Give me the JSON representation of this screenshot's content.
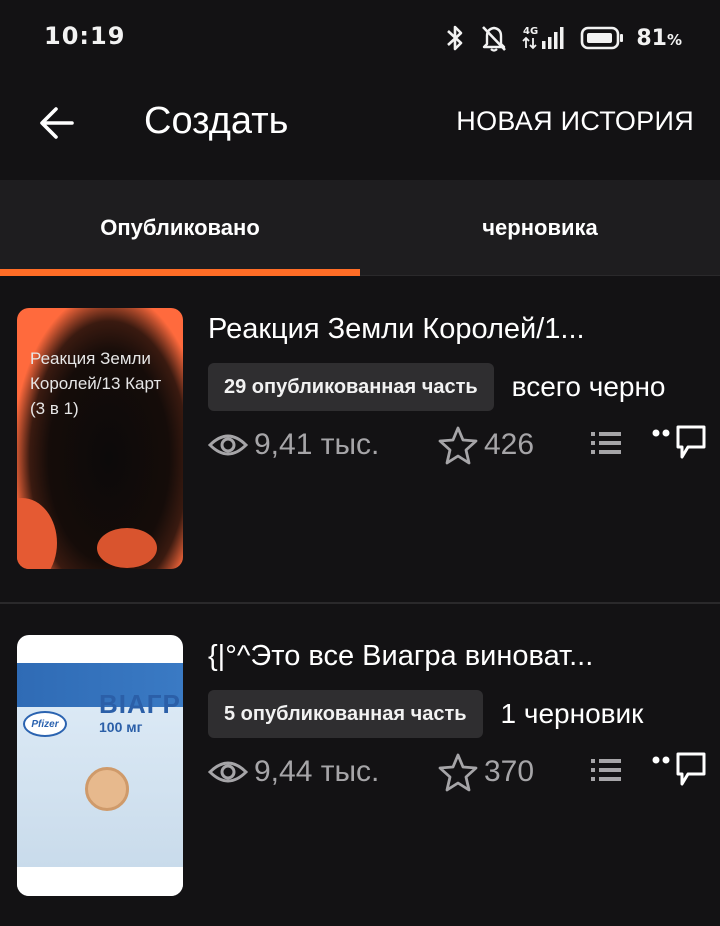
{
  "status_bar": {
    "time": "10:19",
    "network": "4G",
    "battery_percent": "81",
    "battery_unit": "%",
    "icons": [
      "bluetooth-icon",
      "mute-icon",
      "signal-icon",
      "battery-icon"
    ]
  },
  "app_bar": {
    "title": "Создать",
    "new_story_label": "НОВАЯ ИСТОРИЯ",
    "back_icon": "arrow-left-icon"
  },
  "tabs": [
    {
      "label": "Опубликовано",
      "selected": true
    },
    {
      "label": "черновика",
      "selected": false
    }
  ],
  "colors": {
    "accent": "#ff6d26",
    "background": "#131214",
    "tab_bar": "#1e1d1f",
    "badge": "#2f2e30",
    "muted_text": "#a6a5a8"
  },
  "stories": [
    {
      "title": "Реакция Земли Королей/1...",
      "cover_text": "Реакция Земли Королей/13 Карт (3 в 1)",
      "published_parts": "29 опубликованная часть",
      "drafts": "всего черно",
      "reads": "9,41 тыс.",
      "votes": "426"
    },
    {
      "title": "{|°^Это все Виагра виноват...",
      "cover_brand": "ВІАГР",
      "cover_dose": "100 мг",
      "cover_logo": "Pfizer",
      "published_parts": "5 опубликованная часть",
      "drafts": "1 черновик",
      "reads": "9,44 тыс.",
      "votes": "370"
    }
  ]
}
